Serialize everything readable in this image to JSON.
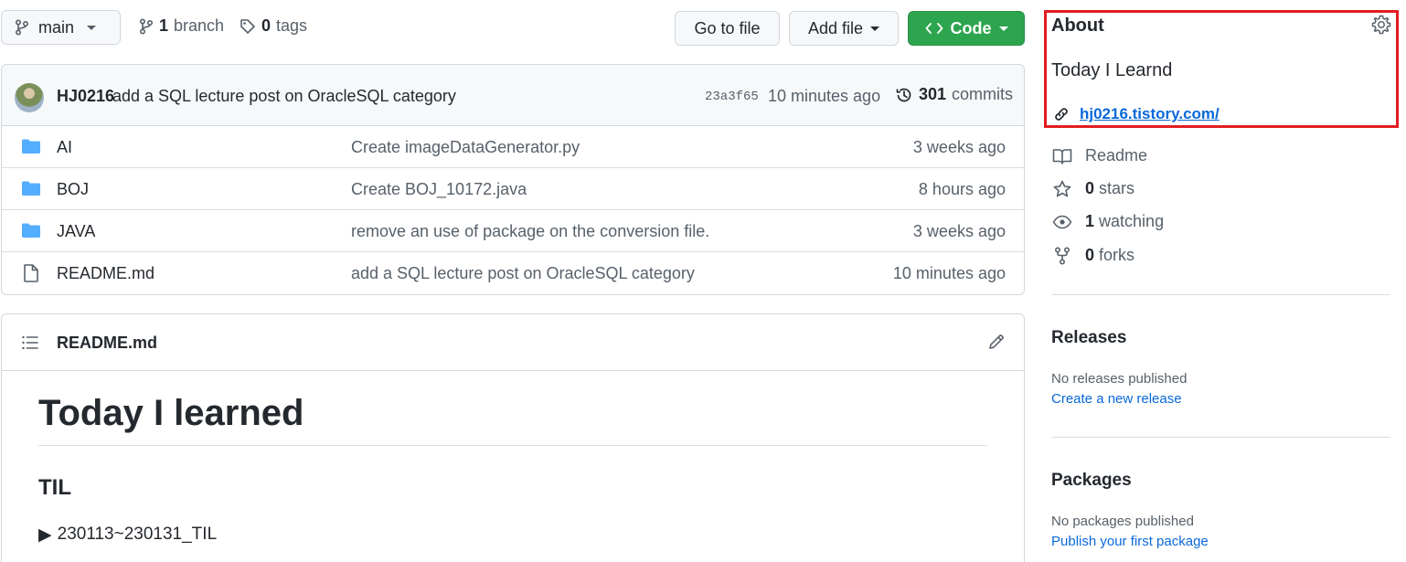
{
  "toolbar": {
    "branch_select": "main",
    "branch_count": "1",
    "branch_label": "branch",
    "tag_count": "0",
    "tag_label": "tags",
    "goto_file": "Go to file",
    "add_file": "Add file",
    "code": "Code",
    "code_color": "#2da44e"
  },
  "latest_commit": {
    "author": "HJ0216",
    "message": "add a SQL lecture post on OracleSQL category",
    "sha": "23a3f65",
    "time": "10 minutes ago",
    "count": "301",
    "count_label": "commits"
  },
  "files": [
    {
      "name": "AI",
      "type": "folder",
      "commit": "Create imageDataGenerator.py",
      "age": "3 weeks ago"
    },
    {
      "name": "BOJ",
      "type": "folder",
      "commit": "Create BOJ_10172.java",
      "age": "8 hours ago"
    },
    {
      "name": "JAVA",
      "type": "folder",
      "commit": "remove an use of package on the conversion file.",
      "age": "3 weeks ago"
    },
    {
      "name": "README.md",
      "type": "file",
      "commit": "add a SQL lecture post on OracleSQL category",
      "age": "10 minutes ago"
    }
  ],
  "readme": {
    "filename": "README.md",
    "h1": "Today I learned",
    "h2": "TIL",
    "details_marker": "▶",
    "details_summary": "230113~230131_TIL"
  },
  "about": {
    "title": "About",
    "description": "Today I Learnd",
    "website": "hj0216.tistory.com/",
    "highlight_color": "#e11d21"
  },
  "stats": {
    "readme": "Readme",
    "stars_count": "0",
    "stars_label": "stars",
    "watching_count": "1",
    "watching_label": "watching",
    "forks_count": "0",
    "forks_label": "forks"
  },
  "releases": {
    "title": "Releases",
    "empty": "No releases published",
    "link": "Create a new release"
  },
  "packages": {
    "title": "Packages",
    "empty": "No packages published",
    "link": "Publish your first package"
  }
}
